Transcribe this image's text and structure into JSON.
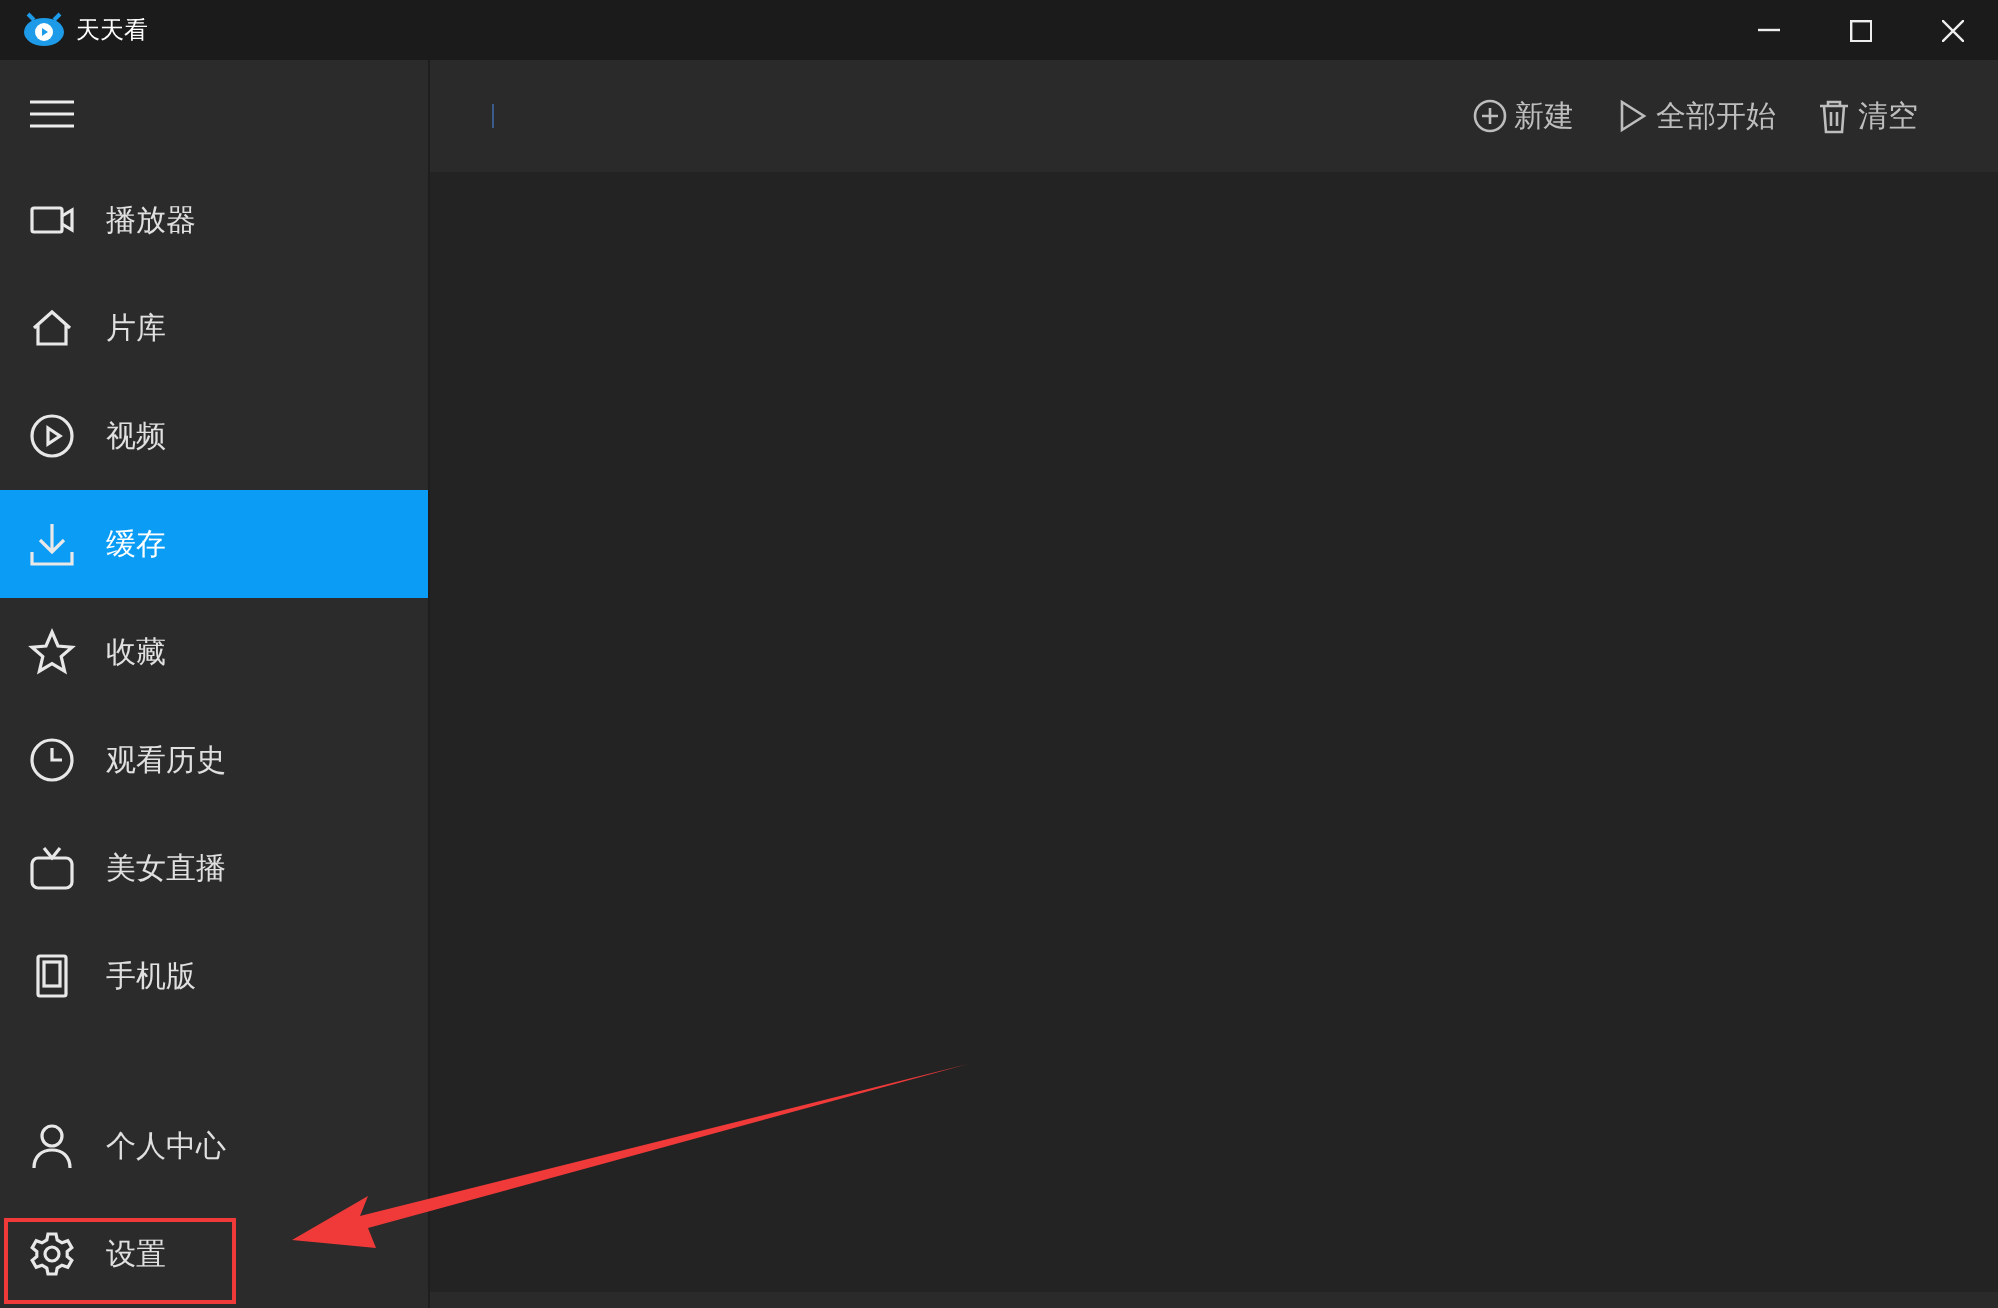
{
  "window": {
    "title": "天天看"
  },
  "sidebar": {
    "items": [
      {
        "label": "播放器",
        "selected": false
      },
      {
        "label": "片库",
        "selected": false
      },
      {
        "label": "视频",
        "selected": false
      },
      {
        "label": "缓存",
        "selected": true
      },
      {
        "label": "收藏",
        "selected": false
      },
      {
        "label": "观看历史",
        "selected": false
      },
      {
        "label": "美女直播",
        "selected": false
      },
      {
        "label": "手机版",
        "selected": false
      }
    ],
    "bottom_items": [
      {
        "label": "个人中心",
        "selected": false
      },
      {
        "label": "设置",
        "selected": false
      }
    ]
  },
  "toolbar": {
    "buttons": [
      {
        "label": "新建"
      },
      {
        "label": "全部开始"
      },
      {
        "label": "清空"
      }
    ]
  },
  "annotations": {
    "highlight_box": true,
    "arrow": true
  }
}
